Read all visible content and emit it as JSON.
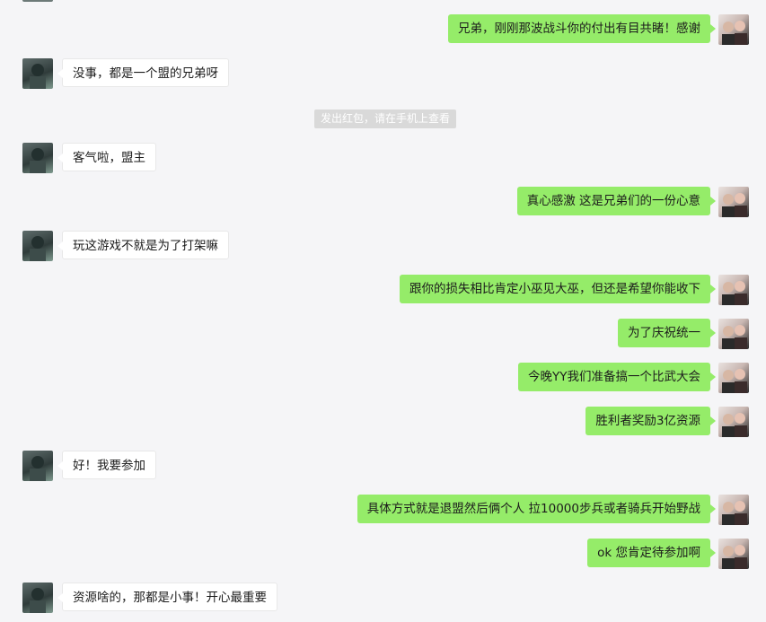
{
  "messages": [
    {
      "side": "right",
      "text": "兄弟，刚刚那波战斗你的付出有目共睹！感谢"
    },
    {
      "side": "left",
      "text": "没事，都是一个盟的兄弟呀"
    },
    {
      "side": "system",
      "text": "发出红包，请在手机上查看"
    },
    {
      "side": "left",
      "text": "客气啦，盟主"
    },
    {
      "side": "right",
      "text": "真心感激 这是兄弟们的一份心意"
    },
    {
      "side": "left",
      "text": "玩这游戏不就是为了打架嘛"
    },
    {
      "side": "right",
      "text": "跟你的损失相比肯定小巫见大巫，但还是希望你能收下"
    },
    {
      "side": "right",
      "text": "为了庆祝统一"
    },
    {
      "side": "right",
      "text": "今晚YY我们准备搞一个比武大会"
    },
    {
      "side": "right",
      "text": "胜利者奖励3亿资源"
    },
    {
      "side": "left",
      "text": "好！我要参加"
    },
    {
      "side": "right",
      "text": "具体方式就是退盟然后俩个人 拉10000步兵或者骑兵开始野战"
    },
    {
      "side": "right",
      "text": "ok 您肯定待参加啊"
    },
    {
      "side": "left",
      "text": "资源啥的，那都是小事！开心最重要"
    }
  ],
  "colors": {
    "outgoing_bubble": "#95ec69",
    "incoming_bubble": "#ffffff",
    "background": "#f5f5f7",
    "system_notice": "#d9d9d9"
  }
}
